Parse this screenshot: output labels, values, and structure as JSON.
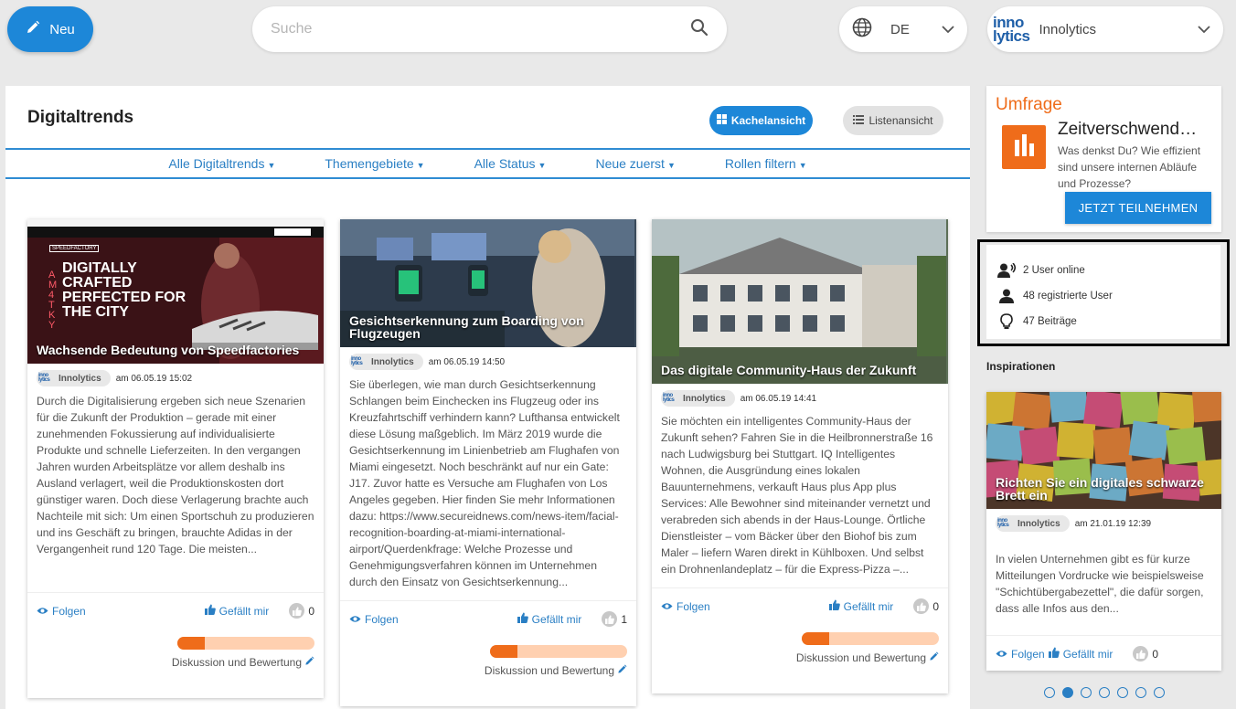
{
  "topbar": {
    "new_label": "Neu",
    "search_placeholder": "Suche",
    "language": "DE",
    "org_name": "Innolytics",
    "org_logo_top": "inno",
    "org_logo_bottom": "lytics"
  },
  "main": {
    "title": "Digitaltrends",
    "view_tiles": "Kachelansicht",
    "view_list": "Listenansicht",
    "filters": [
      "Alle Digitaltrends",
      "Themengebiete",
      "Alle Status",
      "Neue zuerst",
      "Rollen filtern"
    ]
  },
  "cards": [
    {
      "title": "Wachsende Bedeutung von Speedfactories",
      "author": "Innolytics",
      "date": "am 06.05.19 15:02",
      "text": "Durch die Digitalisierung ergeben sich neue Szenarien für die Zukunft der Produktion – gerade mit einer zunehmenden Fokussierung auf individualisierte Produkte und schnelle Lieferzeiten. In den vergangen Jahren wurden Arbeitsplätze vor allem deshalb ins Ausland verlagert, weil die Produktionskosten dort günstiger waren. Doch diese Verlagerung brachte auch Nachteile mit sich: Um einen Sportschuh zu produzieren und ins Geschäft zu bringen, brauchte Adidas in der Vergangenheit rund 120 Tage. Die meisten...",
      "follow": "Folgen",
      "like": "Gefällt mir",
      "likes": "0",
      "discussion": "Diskussion und Bewertung",
      "progress": 0.2,
      "img_headline": "DIGITALLY CRAFTED PERFECTED FOR THE CITY",
      "img_brand": "SPEEDFACTORY",
      "img_side": "AM4TKY"
    },
    {
      "title": "Gesichtserkennung zum Boarding von Flugzeugen",
      "author": "Innolytics",
      "date": "am 06.05.19 14:50",
      "text": "Sie überlegen, wie man durch Gesichtserkennung Schlangen beim Einchecken ins Flugzeug oder ins Kreuzfahrtschiff verhindern kann? Lufthansa entwickelt diese Lösung maßgeblich. Im März 2019 wurde die Gesichtserkennung im Linienbetrieb am Flughafen von Miami eingesetzt. Noch beschränkt auf nur ein Gate: J17. Zuvor hatte es Versuche am Flughafen von Los Angeles gegeben. Hier finden Sie mehr Informationen dazu: https://www.secureidnews.com/news-item/facial-recognition-boarding-at-miami-international-airport/Querdenkfrage: Welche Prozesse und Genehmigungsverfahren können im Unternehmen durch den Einsatz von Gesichtserkennung...",
      "follow": "Folgen",
      "like": "Gefällt mir",
      "likes": "1",
      "discussion": "Diskussion und Bewertung",
      "progress": 0.2
    },
    {
      "title": "Das digitale Community-Haus der Zukunft",
      "author": "Innolytics",
      "date": "am 06.05.19 14:41",
      "text": "Sie möchten ein intelligentes Community-Haus der Zukunft sehen? Fahren Sie in die Heilbronnerstraße 16 nach Ludwigsburg bei Stuttgart. IQ Intelligentes Wohnen, die Ausgründung eines lokalen Bauunternehmens, verkauft Haus plus App plus Services: Alle Bewohner sind miteinander vernetzt und verabreden sich abends in der Haus-Lounge. Örtliche Dienstleister – vom Bäcker über den Biohof bis zum Maler – liefern Waren direkt in Kühlboxen. Und selbst ein Drohnenlandeplatz – für die Express-Pizza –...",
      "follow": "Folgen",
      "like": "Gefällt mir",
      "likes": "0",
      "discussion": "Diskussion und Bewertung",
      "progress": 0.2
    }
  ],
  "survey": {
    "label": "Umfrage",
    "question": "Zeitverschwendung",
    "description": "Was denkst Du? Wie effizient sind unsere internen Abläufe und Prozesse?",
    "button": "JETZT TEILNEHMEN"
  },
  "stats": {
    "online": "2 User online",
    "registered": "48 registrierte User",
    "posts": "47 Beiträge"
  },
  "inspirations": {
    "heading": "Inspirationen",
    "card": {
      "title": "Richten Sie ein digitales schwarze Brett ein",
      "author": "Innolytics",
      "date": "am 21.01.19 12:39",
      "text": "In vielen Unternehmen gibt es für kurze Mitteilungen Vordrucke wie beispielsweise \"Schichtübergabezettel\", die dafür sorgen, dass alle Infos aus den...",
      "follow": "Folgen",
      "like": "Gefällt mir",
      "likes": "0"
    },
    "dots": 7,
    "active_dot": 1
  },
  "colors": {
    "primary": "#1d87d8",
    "accent": "#ef6c1a",
    "link": "#2a7fc4"
  }
}
